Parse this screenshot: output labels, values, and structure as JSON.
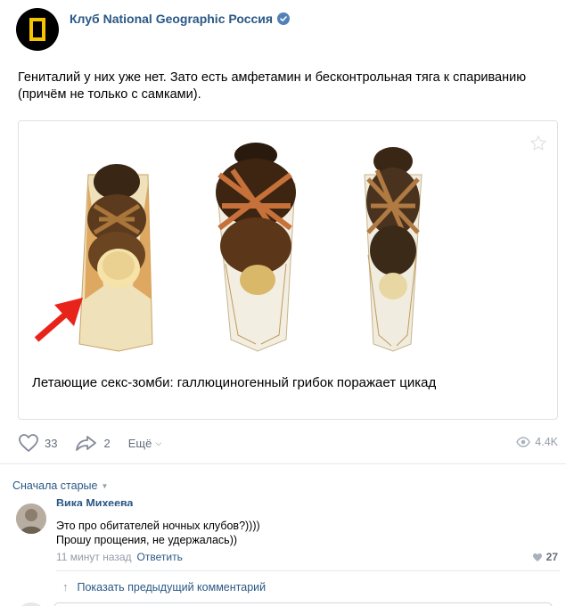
{
  "post": {
    "author": "Клуб National Geographic Россия",
    "text": "Гениталий у них уже нет. Зато есть амфетамин и бесконтрольная тяга к спариванию (причём не только с самками).",
    "link_card": {
      "title": "Летающие секс-зомби: галлюциногенный грибок поражает цикад"
    },
    "actions": {
      "likes": "33",
      "shares": "2",
      "more": "Ещё",
      "views": "4.4K"
    }
  },
  "comments": {
    "sort_label": "Сначала старые",
    "items": [
      {
        "author": "Вика Михеева",
        "line1": "Это про обитателей ночных клубов?))))",
        "line2": "Прошу прощения, не удержалась))",
        "time": "11 минут назад",
        "reply": "Ответить",
        "likes": "27"
      }
    ],
    "show_previous": "Показать предыдущий комментарий"
  },
  "colors": {
    "link": "#2a5885",
    "muted": "#939ca8",
    "accent_arrow": "#e8241a"
  }
}
